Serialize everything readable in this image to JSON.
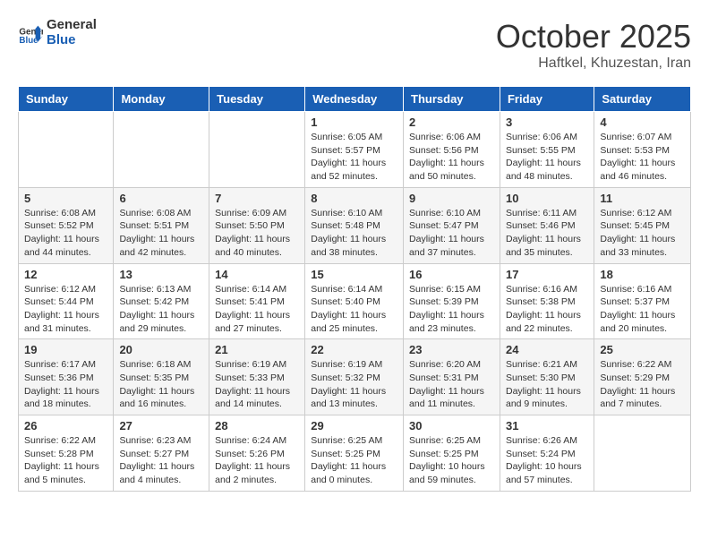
{
  "header": {
    "logo_line1": "General",
    "logo_line2": "Blue",
    "month_title": "October 2025",
    "location": "Haftkel, Khuzestan, Iran"
  },
  "weekdays": [
    "Sunday",
    "Monday",
    "Tuesday",
    "Wednesday",
    "Thursday",
    "Friday",
    "Saturday"
  ],
  "weeks": [
    [
      {
        "day": "",
        "info": ""
      },
      {
        "day": "",
        "info": ""
      },
      {
        "day": "",
        "info": ""
      },
      {
        "day": "1",
        "info": "Sunrise: 6:05 AM\nSunset: 5:57 PM\nDaylight: 11 hours and 52 minutes."
      },
      {
        "day": "2",
        "info": "Sunrise: 6:06 AM\nSunset: 5:56 PM\nDaylight: 11 hours and 50 minutes."
      },
      {
        "day": "3",
        "info": "Sunrise: 6:06 AM\nSunset: 5:55 PM\nDaylight: 11 hours and 48 minutes."
      },
      {
        "day": "4",
        "info": "Sunrise: 6:07 AM\nSunset: 5:53 PM\nDaylight: 11 hours and 46 minutes."
      }
    ],
    [
      {
        "day": "5",
        "info": "Sunrise: 6:08 AM\nSunset: 5:52 PM\nDaylight: 11 hours and 44 minutes."
      },
      {
        "day": "6",
        "info": "Sunrise: 6:08 AM\nSunset: 5:51 PM\nDaylight: 11 hours and 42 minutes."
      },
      {
        "day": "7",
        "info": "Sunrise: 6:09 AM\nSunset: 5:50 PM\nDaylight: 11 hours and 40 minutes."
      },
      {
        "day": "8",
        "info": "Sunrise: 6:10 AM\nSunset: 5:48 PM\nDaylight: 11 hours and 38 minutes."
      },
      {
        "day": "9",
        "info": "Sunrise: 6:10 AM\nSunset: 5:47 PM\nDaylight: 11 hours and 37 minutes."
      },
      {
        "day": "10",
        "info": "Sunrise: 6:11 AM\nSunset: 5:46 PM\nDaylight: 11 hours and 35 minutes."
      },
      {
        "day": "11",
        "info": "Sunrise: 6:12 AM\nSunset: 5:45 PM\nDaylight: 11 hours and 33 minutes."
      }
    ],
    [
      {
        "day": "12",
        "info": "Sunrise: 6:12 AM\nSunset: 5:44 PM\nDaylight: 11 hours and 31 minutes."
      },
      {
        "day": "13",
        "info": "Sunrise: 6:13 AM\nSunset: 5:42 PM\nDaylight: 11 hours and 29 minutes."
      },
      {
        "day": "14",
        "info": "Sunrise: 6:14 AM\nSunset: 5:41 PM\nDaylight: 11 hours and 27 minutes."
      },
      {
        "day": "15",
        "info": "Sunrise: 6:14 AM\nSunset: 5:40 PM\nDaylight: 11 hours and 25 minutes."
      },
      {
        "day": "16",
        "info": "Sunrise: 6:15 AM\nSunset: 5:39 PM\nDaylight: 11 hours and 23 minutes."
      },
      {
        "day": "17",
        "info": "Sunrise: 6:16 AM\nSunset: 5:38 PM\nDaylight: 11 hours and 22 minutes."
      },
      {
        "day": "18",
        "info": "Sunrise: 6:16 AM\nSunset: 5:37 PM\nDaylight: 11 hours and 20 minutes."
      }
    ],
    [
      {
        "day": "19",
        "info": "Sunrise: 6:17 AM\nSunset: 5:36 PM\nDaylight: 11 hours and 18 minutes."
      },
      {
        "day": "20",
        "info": "Sunrise: 6:18 AM\nSunset: 5:35 PM\nDaylight: 11 hours and 16 minutes."
      },
      {
        "day": "21",
        "info": "Sunrise: 6:19 AM\nSunset: 5:33 PM\nDaylight: 11 hours and 14 minutes."
      },
      {
        "day": "22",
        "info": "Sunrise: 6:19 AM\nSunset: 5:32 PM\nDaylight: 11 hours and 13 minutes."
      },
      {
        "day": "23",
        "info": "Sunrise: 6:20 AM\nSunset: 5:31 PM\nDaylight: 11 hours and 11 minutes."
      },
      {
        "day": "24",
        "info": "Sunrise: 6:21 AM\nSunset: 5:30 PM\nDaylight: 11 hours and 9 minutes."
      },
      {
        "day": "25",
        "info": "Sunrise: 6:22 AM\nSunset: 5:29 PM\nDaylight: 11 hours and 7 minutes."
      }
    ],
    [
      {
        "day": "26",
        "info": "Sunrise: 6:22 AM\nSunset: 5:28 PM\nDaylight: 11 hours and 5 minutes."
      },
      {
        "day": "27",
        "info": "Sunrise: 6:23 AM\nSunset: 5:27 PM\nDaylight: 11 hours and 4 minutes."
      },
      {
        "day": "28",
        "info": "Sunrise: 6:24 AM\nSunset: 5:26 PM\nDaylight: 11 hours and 2 minutes."
      },
      {
        "day": "29",
        "info": "Sunrise: 6:25 AM\nSunset: 5:25 PM\nDaylight: 11 hours and 0 minutes."
      },
      {
        "day": "30",
        "info": "Sunrise: 6:25 AM\nSunset: 5:25 PM\nDaylight: 10 hours and 59 minutes."
      },
      {
        "day": "31",
        "info": "Sunrise: 6:26 AM\nSunset: 5:24 PM\nDaylight: 10 hours and 57 minutes."
      },
      {
        "day": "",
        "info": ""
      }
    ]
  ]
}
